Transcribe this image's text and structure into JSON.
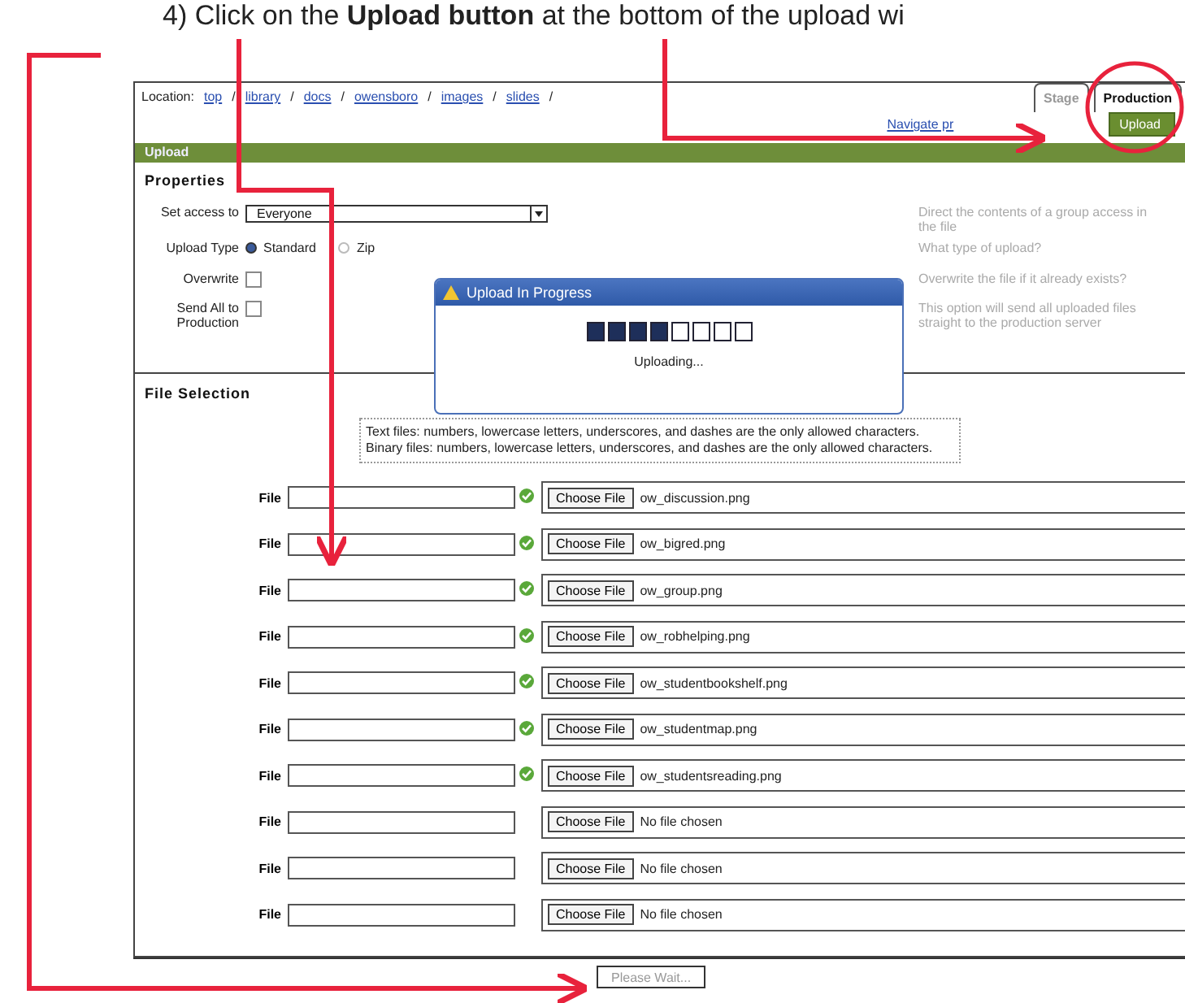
{
  "instruction": "4)  Click on the **Upload button** at the bottom of the upload wi",
  "location": {
    "label": "Location:",
    "links": [
      {
        "label": "top",
        "separator": "/"
      },
      {
        "label": "library",
        "separator": "/"
      },
      {
        "label": "docs",
        "separator": "/"
      },
      {
        "label": "owensboro",
        "separator": "/"
      },
      {
        "label": "images",
        "separator": "/"
      },
      {
        "label": "slides",
        "separator": "/"
      }
    ]
  },
  "tabs": [
    {
      "label": "Stage",
      "selected": false
    },
    {
      "label": "Production",
      "selected": true
    }
  ],
  "navigate_link": "Navigate pr",
  "upload_button": "Upload",
  "section_bar": "Upload",
  "properties": {
    "title": "Properties",
    "access": {
      "label": "Set access to",
      "value": "Everyone",
      "hint": "Direct the contents of a group access in the file"
    },
    "upload_type": {
      "label": "Upload Type",
      "options": [
        {
          "label": "Standard",
          "selected": true
        },
        {
          "label": "Zip",
          "selected": false
        }
      ],
      "hint": "What type of upload?"
    },
    "overwrite": {
      "label": "Overwrite",
      "checked": false,
      "hint": "Overwrite the file if it already exists?"
    },
    "send_all": {
      "label": "Send All to Production",
      "checked": false,
      "hint": "This option will send all uploaded files straight to the production server"
    }
  },
  "dialog": {
    "title": "Upload In Progress",
    "level": 0.5,
    "status": "Uploading..."
  },
  "file_selection": {
    "title": "File Selection",
    "note": "Text files: numbers, lowercase letters, underscores, and dashes are the only allowed characters. Binary files: numbers, lowercase letters, underscores, and dashes are the only allowed characters.",
    "rows": [
      {
        "label": "File",
        "button": "Choose File",
        "file": "ow_discussion.png",
        "done": true
      },
      {
        "label": "File",
        "button": "Choose File",
        "file": "ow_bigred.png",
        "done": true
      },
      {
        "label": "File",
        "button": "Choose File",
        "file": "ow_group.png",
        "done": true
      },
      {
        "label": "File",
        "button": "Choose File",
        "file": "ow_robhelping.png",
        "done": true
      },
      {
        "label": "File",
        "button": "Choose File",
        "file": "ow_studentbookshelf.png",
        "done": true
      },
      {
        "label": "File",
        "button": "Choose File",
        "file": "ow_studentmap.png",
        "done": true
      },
      {
        "label": "File",
        "button": "Choose File",
        "file": "ow_studentsreading.png",
        "done": true
      },
      {
        "label": "File",
        "button": "Choose File",
        "file": "No file chosen",
        "done": false
      },
      {
        "label": "File",
        "button": "Choose File",
        "file": "No file chosen",
        "done": false
      },
      {
        "label": "File",
        "button": "Choose File",
        "file": "No file chosen",
        "done": false
      }
    ]
  },
  "submit_button": "Please Wait..."
}
